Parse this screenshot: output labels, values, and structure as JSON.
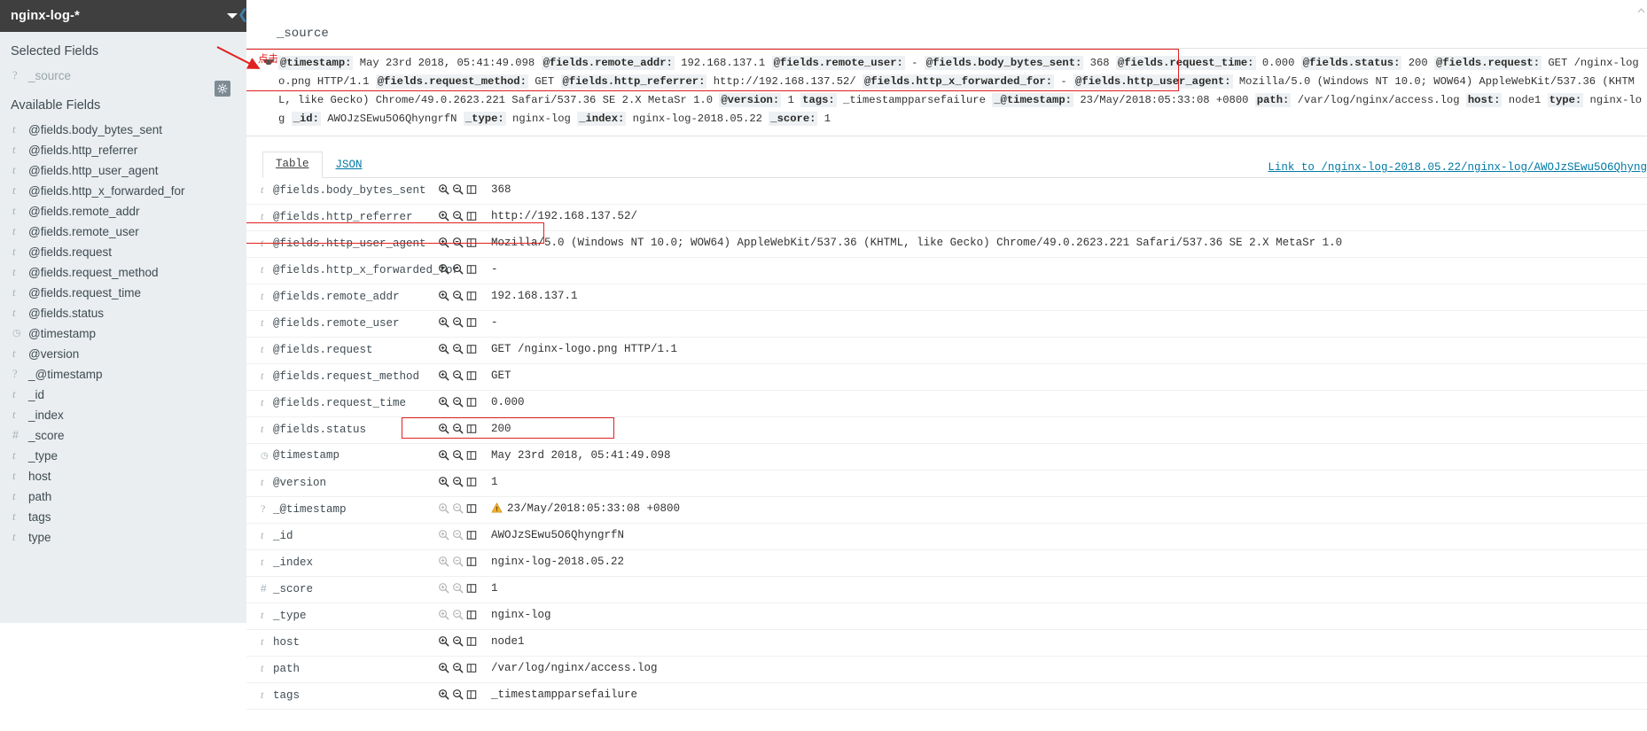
{
  "sidebar": {
    "index_pattern": "nginx-log-*",
    "selected_fields_title": "Selected Fields",
    "available_fields_title": "Available Fields",
    "selected_fields": [
      {
        "type": "?",
        "name": "_source"
      }
    ],
    "available_fields": [
      {
        "type": "t",
        "name": "@fields.body_bytes_sent"
      },
      {
        "type": "t",
        "name": "@fields.http_referrer"
      },
      {
        "type": "t",
        "name": "@fields.http_user_agent"
      },
      {
        "type": "t",
        "name": "@fields.http_x_forwarded_for"
      },
      {
        "type": "t",
        "name": "@fields.remote_addr"
      },
      {
        "type": "t",
        "name": "@fields.remote_user"
      },
      {
        "type": "t",
        "name": "@fields.request"
      },
      {
        "type": "t",
        "name": "@fields.request_method"
      },
      {
        "type": "t",
        "name": "@fields.request_time"
      },
      {
        "type": "t",
        "name": "@fields.status"
      },
      {
        "type": "date",
        "name": "@timestamp"
      },
      {
        "type": "t",
        "name": "@version"
      },
      {
        "type": "?",
        "name": "_@timestamp"
      },
      {
        "type": "t",
        "name": "_id"
      },
      {
        "type": "t",
        "name": "_index"
      },
      {
        "type": "#",
        "name": "_score"
      },
      {
        "type": "t",
        "name": "_type"
      },
      {
        "type": "t",
        "name": "host"
      },
      {
        "type": "t",
        "name": "path"
      },
      {
        "type": "t",
        "name": "tags"
      },
      {
        "type": "t",
        "name": "type"
      }
    ]
  },
  "doc": {
    "column_header": "_source",
    "source_pairs": [
      {
        "key": "@timestamp:",
        "value": "May 23rd 2018, 05:41:49.098"
      },
      {
        "key": "@fields.remote_addr:",
        "value": "192.168.137.1"
      },
      {
        "key": "@fields.remote_user:",
        "value": "-"
      },
      {
        "key": "@fields.body_bytes_sent:",
        "value": "368"
      },
      {
        "key": "@fields.request_time:",
        "value": "0.000"
      },
      {
        "key": "@fields.status:",
        "value": "200"
      },
      {
        "key": "@fields.request:",
        "value": "GET /nginx-logo.png HTTP/1.1"
      },
      {
        "key": "@fields.request_method:",
        "value": "GET"
      },
      {
        "key": "@fields.http_referrer:",
        "value": "http://192.168.137.52/"
      },
      {
        "key": "@fields.http_x_forwarded_for:",
        "value": "-"
      },
      {
        "key": "@fields.http_user_agent:",
        "value": "Mozilla/5.0 (Windows NT 10.0; WOW64) AppleWebKit/537.36 (KHTML, like Gecko) Chrome/49.0.2623.221 Safari/537.36 SE 2.X MetaSr 1.0"
      },
      {
        "key": "@version:",
        "value": "1"
      },
      {
        "key": "tags:",
        "value": "_timestampparsefailure"
      },
      {
        "key": "_@timestamp:",
        "value": "23/May/2018:05:33:08 +0800"
      },
      {
        "key": "path:",
        "value": "/var/log/nginx/access.log"
      },
      {
        "key": "host:",
        "value": "node1"
      },
      {
        "key": "type:",
        "value": "nginx-log"
      },
      {
        "key": "_id:",
        "value": "AWOJzSEwu5O6QhyngrfN"
      },
      {
        "key": "_type:",
        "value": "nginx-log"
      },
      {
        "key": "_index:",
        "value": "nginx-log-2018.05.22"
      },
      {
        "key": "_score:",
        "value": "1"
      }
    ]
  },
  "tabs": [
    {
      "label": "Table",
      "active": true
    },
    {
      "label": "JSON",
      "active": false
    }
  ],
  "doc_link": "Link to /nginx-log-2018.05.22/nginx-log/AWOJzSEwu5O6Qhyng",
  "table": {
    "rows": [
      {
        "type": "t",
        "name": "@fields.body_bytes_sent",
        "value": "368",
        "actions": true,
        "warn": false
      },
      {
        "type": "t",
        "name": "@fields.http_referrer",
        "value": "http://192.168.137.52/",
        "actions": true,
        "warn": false
      },
      {
        "type": "t",
        "name": "@fields.http_user_agent",
        "value": "Mozilla/5.0 (Windows NT 10.0; WOW64) AppleWebKit/537.36 (KHTML, like Gecko) Chrome/49.0.2623.221 Safari/537.36 SE 2.X MetaSr 1.0",
        "actions": true,
        "warn": false
      },
      {
        "type": "t",
        "name": "@fields.http_x_forwarded_for",
        "value": "-",
        "actions": true,
        "warn": false
      },
      {
        "type": "t",
        "name": "@fields.remote_addr",
        "value": "192.168.137.1",
        "actions": true,
        "warn": false
      },
      {
        "type": "t",
        "name": "@fields.remote_user",
        "value": "-",
        "actions": true,
        "warn": false
      },
      {
        "type": "t",
        "name": "@fields.request",
        "value": "GET /nginx-logo.png HTTP/1.1",
        "actions": true,
        "warn": false
      },
      {
        "type": "t",
        "name": "@fields.request_method",
        "value": "GET",
        "actions": true,
        "warn": false
      },
      {
        "type": "t",
        "name": "@fields.request_time",
        "value": "0.000",
        "actions": true,
        "warn": false
      },
      {
        "type": "t",
        "name": "@fields.status",
        "value": "200",
        "actions": true,
        "warn": false
      },
      {
        "type": "date",
        "name": "@timestamp",
        "value": "May 23rd 2018, 05:41:49.098",
        "actions": true,
        "warn": false
      },
      {
        "type": "t",
        "name": "@version",
        "value": "1",
        "actions": true,
        "warn": false
      },
      {
        "type": "?",
        "name": "_@timestamp",
        "value": "23/May/2018:05:33:08 +0800",
        "actions": false,
        "warn": true
      },
      {
        "type": "t",
        "name": "_id",
        "value": "AWOJzSEwu5O6QhyngrfN",
        "actions": false,
        "warn": false
      },
      {
        "type": "t",
        "name": "_index",
        "value": "nginx-log-2018.05.22",
        "actions": false,
        "warn": false
      },
      {
        "type": "#",
        "name": "_score",
        "value": "1",
        "actions": false,
        "warn": false
      },
      {
        "type": "t",
        "name": "_type",
        "value": "nginx-log",
        "actions": false,
        "warn": false
      },
      {
        "type": "t",
        "name": "host",
        "value": "node1",
        "actions": true,
        "warn": false
      },
      {
        "type": "t",
        "name": "path",
        "value": "/var/log/nginx/access.log",
        "actions": true,
        "warn": false
      },
      {
        "type": "t",
        "name": "tags",
        "value": "_timestampparsefailure",
        "actions": true,
        "warn": false
      }
    ]
  },
  "annotations": {
    "click_label": "点击"
  },
  "colors": {
    "accent_link": "#0079a5",
    "annotation_red": "#e02020",
    "sidebar_bg": "#eaeef0",
    "index_bar_bg": "#3f3f3f"
  }
}
